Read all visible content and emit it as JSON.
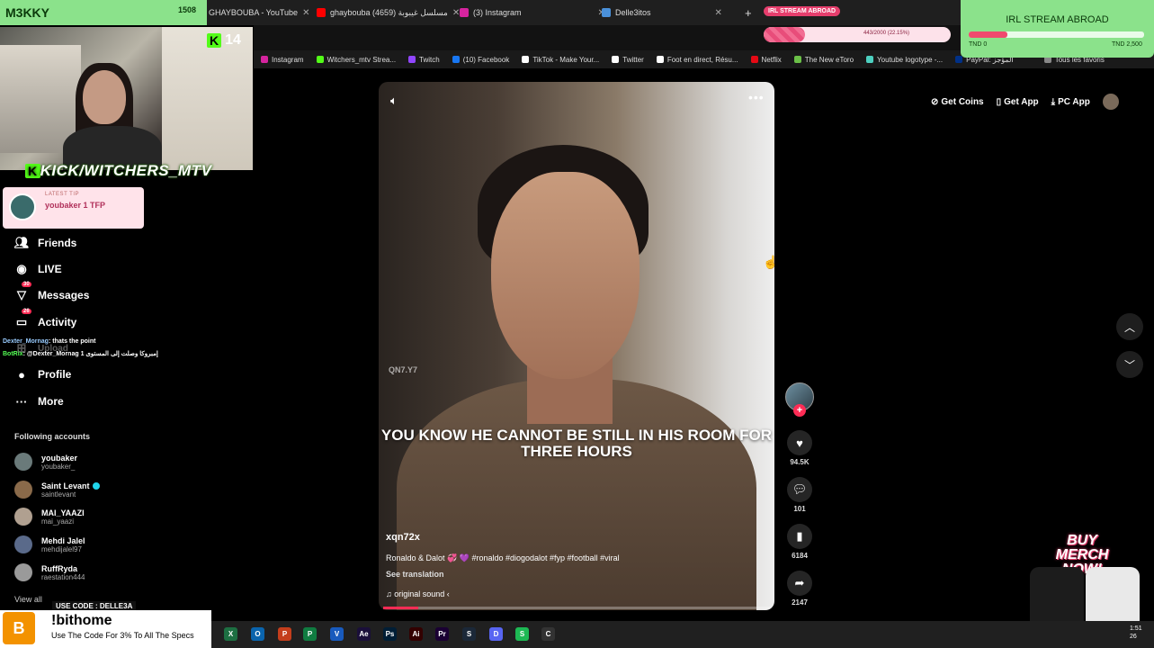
{
  "browser": {
    "tabs": [
      {
        "label": "GHAYBOUBA - YouTube",
        "color": "#1f1f1f"
      },
      {
        "label": "ghaybouba مسلسل غيبوبة (4659)",
        "color": "#ff0000"
      },
      {
        "label": "(3) Instagram",
        "color": "#d6249f"
      },
      {
        "label": "Delle3itos",
        "color": "#4a90d9"
      }
    ],
    "tab_goal_pill": "IRL STREAM ABROAD",
    "bookmarks": [
      {
        "label": "Instagram",
        "color": "#d6249f"
      },
      {
        "label": "Witchers_mtv Strea...",
        "color": "#53fc18"
      },
      {
        "label": "Twitch",
        "color": "#9146ff"
      },
      {
        "label": "(10) Facebook",
        "color": "#1877f2"
      },
      {
        "label": "TikTok - Make Your...",
        "color": "#ffffff"
      },
      {
        "label": "Twitter",
        "color": "#ffffff"
      },
      {
        "label": "Foot en direct, Résu...",
        "color": "#ffffff"
      },
      {
        "label": "Netflix",
        "color": "#e50914"
      },
      {
        "label": "The New eToro",
        "color": "#6bc048"
      },
      {
        "label": "Youtube logotype -...",
        "color": "#4dd0c0"
      },
      {
        "label": "PayPal: المؤجز",
        "color": "#003087"
      },
      {
        "label": "Tous les favoris",
        "color": "#888888"
      }
    ]
  },
  "stream": {
    "name": "M3KKY",
    "viewers": "1508",
    "kick_count": "14",
    "kick_handle": "KICK/WITCHERS_MTV",
    "latest_tip_label": "LATEST TIP",
    "latest_tip": "youbaker 1 TFP",
    "chat": [
      {
        "user": "Dexter_Mornag",
        "text": ": thats the point"
      },
      {
        "user": "BotRix",
        "text": ": @Dexter_Mornag إمبروكا وصلت إلى المستوى 1"
      }
    ],
    "goal": {
      "title": "IRL STREAM ABROAD",
      "min": "TND 0",
      "max": "TND 2,500",
      "progress": 0.22
    },
    "big_bar_text": "443/2000 (22.15%)",
    "big_bar_progress": 0.22,
    "merch": "BUY MERCH NOW!",
    "promo": {
      "code_label": "USE CODE : DELLE3A",
      "command": "!bithome",
      "sub": "Use The Code For 3% To All The Specs",
      "logo": "B"
    }
  },
  "tiktok": {
    "nav": [
      {
        "label": "Friends",
        "icon": "friends-icon",
        "badge": ""
      },
      {
        "label": "LIVE",
        "icon": "live-icon",
        "badge": ""
      },
      {
        "label": "Messages",
        "icon": "messages-icon",
        "badge": "30"
      },
      {
        "label": "Activity",
        "icon": "activity-icon",
        "badge": "26"
      },
      {
        "label": "Upload",
        "icon": "upload-icon",
        "badge": ""
      },
      {
        "label": "Profile",
        "icon": "profile-icon",
        "badge": ""
      },
      {
        "label": "More",
        "icon": "more-icon",
        "badge": ""
      }
    ],
    "following_title": "Following accounts",
    "accounts": [
      {
        "name": "youbaker",
        "handle": "youbaker_",
        "verified": false
      },
      {
        "name": "Saint Levant",
        "handle": "saintlevant",
        "verified": true
      },
      {
        "name": "MAI_YAAZI",
        "handle": "mai_yaazi",
        "verified": false
      },
      {
        "name": "Mehdi Jalel",
        "handle": "mehdijalel97",
        "verified": false
      },
      {
        "name": "RuffRyda",
        "handle": "raestation444",
        "verified": false
      }
    ],
    "view_all": "View all",
    "header": {
      "get_coins": "Get Coins",
      "get_app": "Get App",
      "pc_app": "PC App"
    },
    "video": {
      "caption": "YOU KNOW HE CANNOT BE STILL IN HIS ROOM FOR THREE HOURS",
      "watermark": "QN7.Y7",
      "author": "xqn72x",
      "description": "Ronaldo & Dalot 💞 💜 #ronaldo #diogodalot #fyp #football #viral",
      "see_translation": "See translation",
      "sound": "original sound ‹",
      "progress": 0.09
    },
    "actions": {
      "likes": "94.5K",
      "comments": "101",
      "saves": "6184",
      "shares": "2147"
    }
  },
  "taskbar": {
    "apps": [
      {
        "label": "X",
        "color": "#1d6f42"
      },
      {
        "label": "O",
        "color": "#0a64ad"
      },
      {
        "label": "P",
        "color": "#c43e1c"
      },
      {
        "label": "P",
        "color": "#107c41"
      },
      {
        "label": "V",
        "color": "#185abd"
      },
      {
        "label": "Ae",
        "color": "#1a0f3a"
      },
      {
        "label": "Ps",
        "color": "#001e36"
      },
      {
        "label": "Ai",
        "color": "#330000"
      },
      {
        "label": "Pr",
        "color": "#1a0033"
      },
      {
        "label": "S",
        "color": "#1b2838"
      },
      {
        "label": "D",
        "color": "#5865f2"
      },
      {
        "label": "S",
        "color": "#1db954"
      },
      {
        "label": "C",
        "color": "#333333"
      }
    ],
    "time": "1:51",
    "date": "26"
  }
}
